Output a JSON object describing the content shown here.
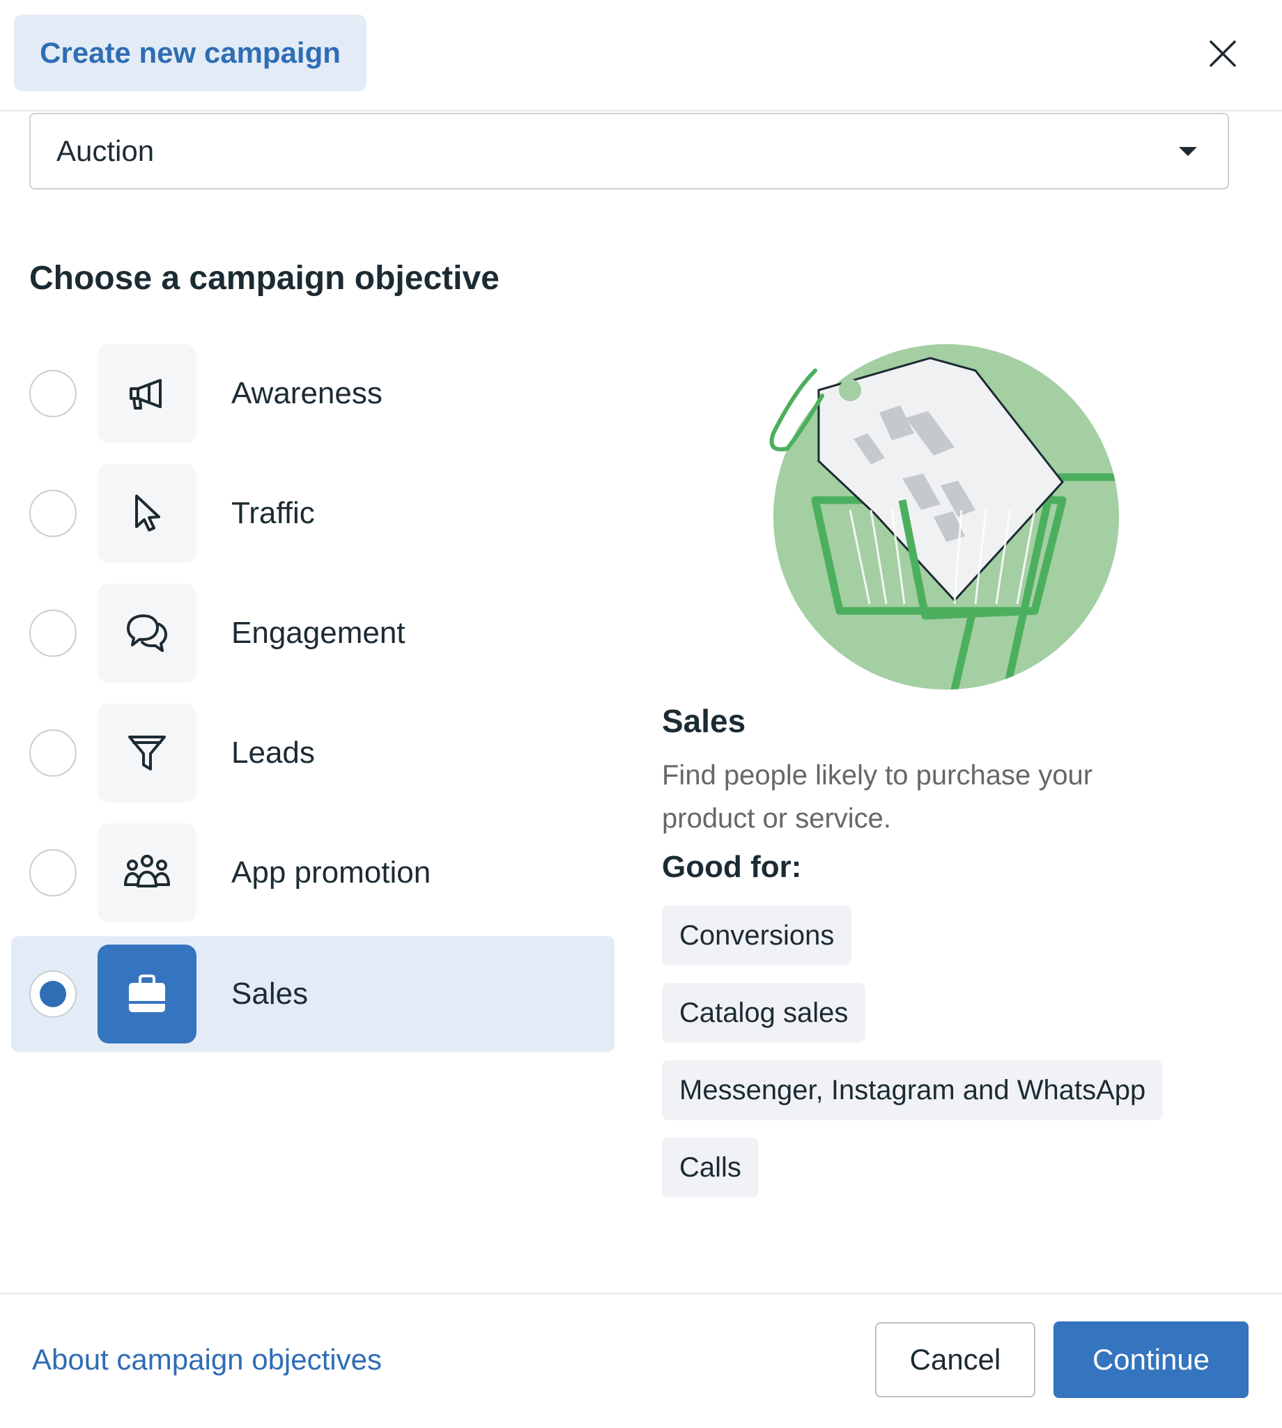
{
  "header": {
    "create_label": "Create new campaign"
  },
  "buying_type": {
    "selected": "Auction"
  },
  "objective_section": {
    "title": "Choose a campaign objective"
  },
  "objectives": [
    {
      "label": "Awareness",
      "icon": "megaphone-icon"
    },
    {
      "label": "Traffic",
      "icon": "cursor-icon"
    },
    {
      "label": "Engagement",
      "icon": "chat-bubbles-icon"
    },
    {
      "label": "Leads",
      "icon": "funnel-icon"
    },
    {
      "label": "App promotion",
      "icon": "people-icon"
    },
    {
      "label": "Sales",
      "icon": "shopping-bag-icon",
      "selected": true
    }
  ],
  "details": {
    "title": "Sales",
    "description": "Find people likely to purchase your product or service.",
    "good_for_label": "Good for:",
    "good_for": [
      "Conversions",
      "Catalog sales",
      "Messenger, Instagram and WhatsApp",
      "Calls"
    ]
  },
  "footer": {
    "about_link": "About campaign objectives",
    "cancel_label": "Cancel",
    "continue_label": "Continue"
  },
  "colors": {
    "accent": "#3574be",
    "selected_bg": "#e3ecf6",
    "illustration_green": "#a3cfa3",
    "illustration_dark_green": "#4caf5e"
  }
}
